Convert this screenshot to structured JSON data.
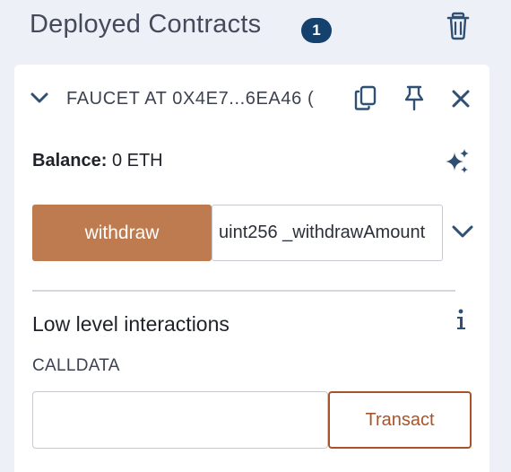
{
  "header": {
    "title": "Deployed Contracts",
    "count": "1",
    "trash_icon": "trash-icon"
  },
  "contract": {
    "name": "FAUCET AT 0X4E7...6EA46 (",
    "expanded": true,
    "actions": [
      "copy-icon",
      "pin-icon",
      "close-icon"
    ]
  },
  "balance": {
    "label": "Balance:",
    "value": "0 ETH"
  },
  "functions": [
    {
      "button_label": "withdraw",
      "input_placeholder": "uint256 _withdrawAmount",
      "input_value": ""
    }
  ],
  "low_level": {
    "title": "Low level interactions",
    "calldata_label": "CALLDATA",
    "calldata_value": "",
    "transact_label": "Transact"
  },
  "colors": {
    "background": "#eef0f7",
    "badge": "#15416e",
    "withdraw_button": "#bf7b50",
    "transact_accent": "#a8542a",
    "icon": "#2f5072"
  }
}
